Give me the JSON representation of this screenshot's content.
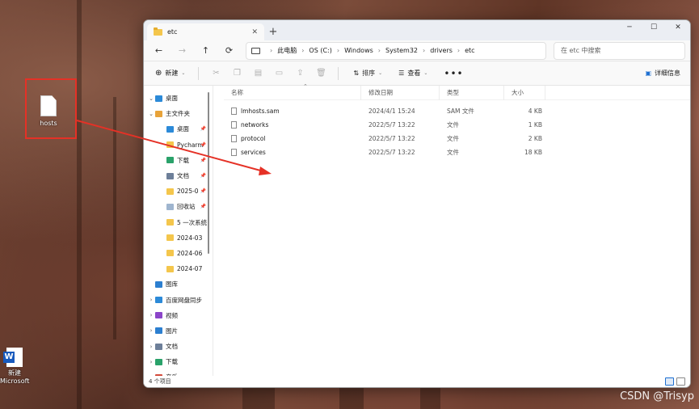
{
  "desktop": {
    "hosts_label": "hosts",
    "word_label_line1": "新建",
    "word_label_line2": "Microsoft",
    "watermark": "CSDN @Trisyp"
  },
  "window": {
    "tab_title": "etc",
    "tab_close": "✕",
    "new_tab": "+",
    "controls": {
      "minimize": "─",
      "maximize": "☐",
      "close": "✕"
    }
  },
  "nav": {
    "back": "←",
    "forward": "→",
    "up": "↑",
    "refresh": "⟳",
    "breadcrumb": [
      "此电脑",
      "OS (C:)",
      "Windows",
      "System32",
      "drivers",
      "etc"
    ],
    "search_placeholder": "在 etc 中搜索"
  },
  "toolbar": {
    "new_label": "新建",
    "sort_label": "排序",
    "view_label": "查看",
    "more_label": "•••",
    "details_label": "详细信息"
  },
  "sidebar": {
    "items": [
      {
        "label": "桌面",
        "chev": "⌄",
        "color": "#2c8ad8",
        "pinned": false
      },
      {
        "label": "主文件夹",
        "chev": "⌄",
        "color": "#e8a33a",
        "pinned": false
      },
      {
        "label": "桌面",
        "chev": "",
        "color": "#2c8ad8",
        "pinned": true
      },
      {
        "label": "Pycharm",
        "chev": "",
        "color": "#f4c64c",
        "pinned": true
      },
      {
        "label": "下载",
        "chev": "",
        "color": "#2aa26a",
        "pinned": true
      },
      {
        "label": "文档",
        "chev": "",
        "color": "#6d7f99",
        "pinned": true
      },
      {
        "label": "2025-0",
        "chev": "",
        "color": "#f4c64c",
        "pinned": true
      },
      {
        "label": "回收站",
        "chev": "",
        "color": "#9fb5cf",
        "pinned": true
      },
      {
        "label": "5 一次系统",
        "chev": "",
        "color": "#f4c64c",
        "pinned": false
      },
      {
        "label": "2024-03",
        "chev": "",
        "color": "#f4c64c",
        "pinned": false
      },
      {
        "label": "2024-06",
        "chev": "",
        "color": "#f4c64c",
        "pinned": false
      },
      {
        "label": "2024-07",
        "chev": "",
        "color": "#f4c64c",
        "pinned": false
      },
      {
        "label": "图库",
        "chev": "",
        "color": "#2c7fd0",
        "pinned": false
      },
      {
        "label": "百度网盘同步",
        "chev": "›",
        "color": "#2c8ad8",
        "pinned": false
      },
      {
        "label": "视频",
        "chev": "›",
        "color": "#8b45c9",
        "pinned": false
      },
      {
        "label": "图片",
        "chev": "›",
        "color": "#2c7fd0",
        "pinned": false
      },
      {
        "label": "文档",
        "chev": "›",
        "color": "#6d7f99",
        "pinned": false
      },
      {
        "label": "下载",
        "chev": "›",
        "color": "#2aa26a",
        "pinned": false
      },
      {
        "label": "音乐",
        "chev": "›",
        "color": "#d34a3b",
        "pinned": false
      }
    ]
  },
  "table": {
    "columns": [
      "名称",
      "修改日期",
      "类型",
      "大小"
    ],
    "rows": [
      {
        "name": "lmhosts.sam",
        "date": "2024/4/1 15:24",
        "type": "SAM 文件",
        "size": "4 KB"
      },
      {
        "name": "networks",
        "date": "2022/5/7 13:22",
        "type": "文件",
        "size": "1 KB"
      },
      {
        "name": "protocol",
        "date": "2022/5/7 13:22",
        "type": "文件",
        "size": "2 KB"
      },
      {
        "name": "services",
        "date": "2022/5/7 13:22",
        "type": "文件",
        "size": "18 KB"
      }
    ]
  },
  "status": {
    "count": "4 个项目"
  },
  "colors": {
    "annotation": "#e53126",
    "accent": "#1d6fd1"
  }
}
